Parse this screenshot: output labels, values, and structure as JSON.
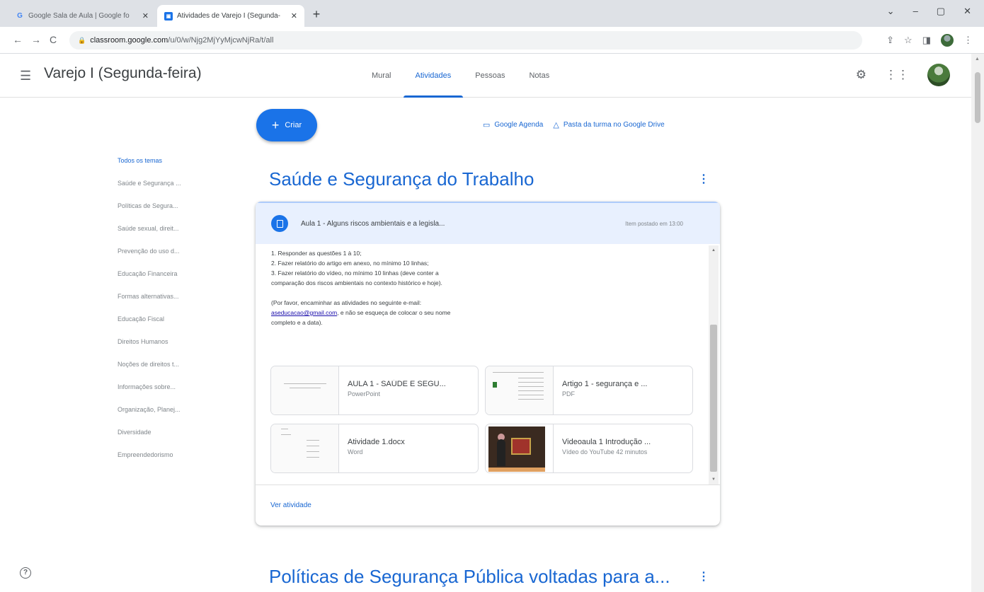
{
  "browser": {
    "tabs": [
      {
        "title": "Google Sala de Aula | Google fo",
        "favicon": "google-g",
        "active": false
      },
      {
        "title": "Atividades de Varejo I (Segunda-",
        "favicon": "classroom",
        "active": true
      }
    ],
    "new_tab": "+",
    "window_controls": [
      "⌄",
      "–",
      "▢",
      "✕"
    ],
    "url_host": "classroom.google.com",
    "url_path": "/u/0/w/Njg2MjYyMjcwNjRa/t/all"
  },
  "app": {
    "class_name": "Varejo I (Segunda-feira)",
    "nav_tabs": [
      "Mural",
      "Atividades",
      "Pessoas",
      "Notas"
    ],
    "active_tab": "Atividades"
  },
  "actions": {
    "create_label": "Criar",
    "calendar_link": "Google Agenda",
    "drive_link": "Pasta da turma no Google Drive"
  },
  "topics": [
    "Todos os temas",
    "Saúde e Segurança ...",
    "Políticas de Segura...",
    "Saúde sexual, direit...",
    "Prevenção do uso d...",
    "Educação Financeira",
    "Formas alternativas...",
    "Educação Fiscal",
    "Direitos Humanos",
    "Noções de direitos t...",
    "Informações sobre...",
    "Organização, Planej...",
    "Diversidade",
    "Empreendedorismo"
  ],
  "section1": {
    "title": "Saúde e Segurança do Trabalho",
    "assignment": {
      "title": "Aula 1 - Alguns riscos ambientais e a legisla...",
      "date": "Item postado em 13:00",
      "description_lines": [
        "1. Responder as questões 1 à 10;",
        "2. Fazer relatório do artigo em anexo, no mínimo 10 linhas;",
        "3. Fazer relatório do vídeo, no  mínimo 10 linhas (deve conter a",
        "comparação dos riscos ambientais no contexto histórico e hoje).",
        "",
        "(Por favor, encaminhar as atividades no seguinte e-mail:"
      ],
      "email": "aseducacao@gmail.com",
      "email_suffix": ", e não se esqueça de colocar o seu nome",
      "description_last": "completo e a data).",
      "attachments": [
        {
          "name": "AULA 1 - SAÚDE E SEGU...",
          "type": "PowerPoint"
        },
        {
          "name": "Artigo 1 - segurança e ...",
          "type": "PDF"
        },
        {
          "name": "Atividade 1.docx",
          "type": "Word"
        },
        {
          "name": "Videoaula 1 Introdução ...",
          "type": "Vídeo do YouTube   42 minutos"
        }
      ],
      "view_label": "Ver atividade"
    }
  },
  "section2": {
    "title": "Políticas de Segurança Pública voltadas para a..."
  },
  "colors": {
    "accent": "#1967d2",
    "button": "#1a73e8",
    "card_header": "#e8f0fe"
  }
}
